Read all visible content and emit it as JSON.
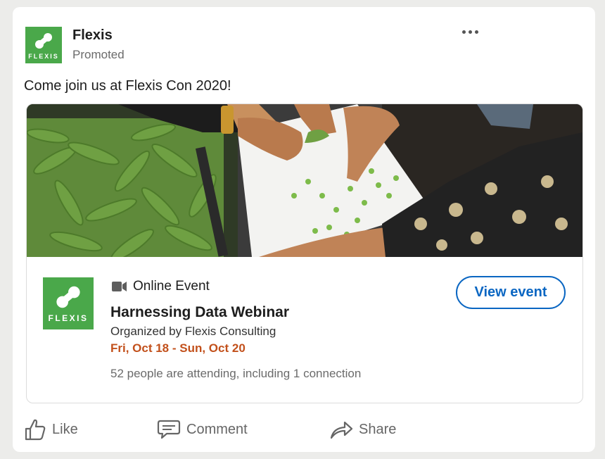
{
  "post": {
    "author": "Flexis",
    "subtitle": "Promoted",
    "text": "Come join us at Flexis Con 2020!",
    "logo_text": "FLEXIS"
  },
  "event": {
    "type_label": "Online Event",
    "title": "Harnessing Data Webinar",
    "organizer": "Organized by Flexis Consulting",
    "dates": "Fri, Oct 18 - Sun, Oct 20",
    "attendance": "52 people are attending, including 1 connection",
    "cta_label": "View event",
    "logo_text": "FLEXIS"
  },
  "actions": {
    "like": "Like",
    "comment": "Comment",
    "share": "Share"
  },
  "icons": {
    "more": "more-options-icon",
    "video": "video-camera-icon",
    "like": "thumbs-up-icon",
    "comment": "comment-bubble-icon",
    "share": "share-arrow-icon"
  },
  "colors": {
    "brand_green": "#4aa84a",
    "link_blue": "#0a66c2",
    "date_orange": "#c2501b"
  }
}
